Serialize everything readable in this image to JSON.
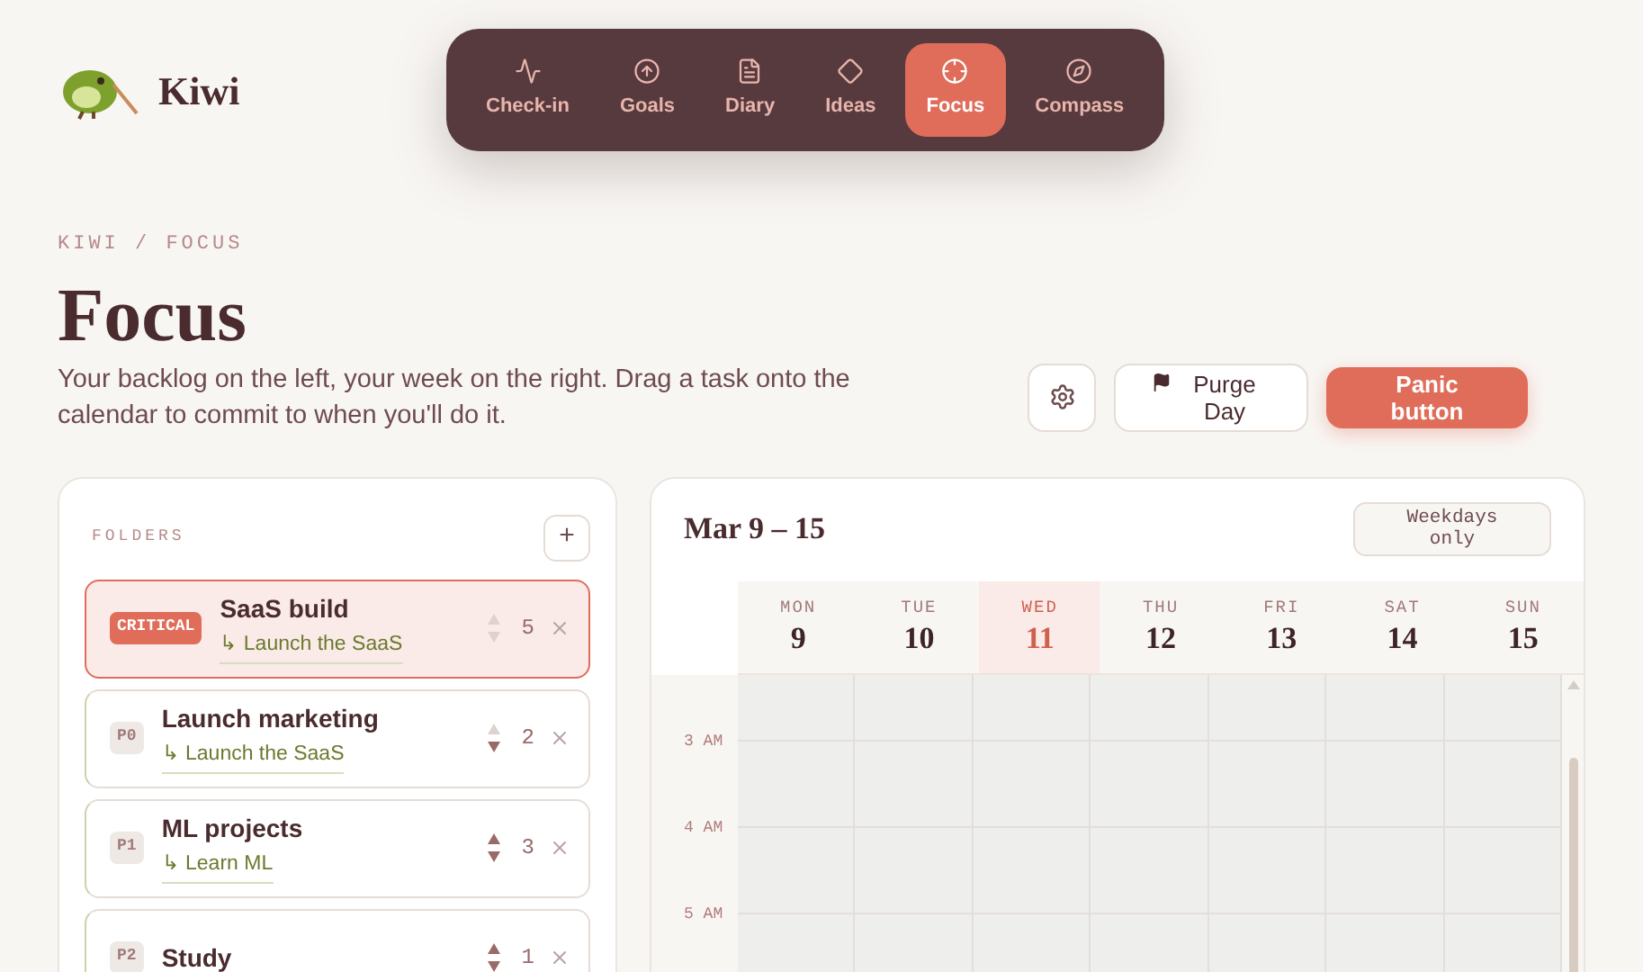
{
  "brand": {
    "name": "Kiwi"
  },
  "nav": [
    {
      "label": "Check-in",
      "selected": false
    },
    {
      "label": "Goals",
      "selected": false
    },
    {
      "label": "Diary",
      "selected": false
    },
    {
      "label": "Ideas",
      "selected": false
    },
    {
      "label": "Focus",
      "selected": true
    },
    {
      "label": "Compass",
      "selected": false
    }
  ],
  "breadcrumb": "KIWI / FOCUS",
  "title": "Focus",
  "subtitle": "Your backlog on the left, your week on the right. Drag a task onto the calendar to commit to when you'll do it.",
  "actions": [
    {
      "kind": "icon"
    },
    {
      "kind": "flag",
      "label": "Purge Day"
    },
    {
      "kind": "primary",
      "label": "Panic button"
    }
  ],
  "folders": {
    "heading": "FOLDERS",
    "add": "+",
    "items": [
      {
        "priority": "CRITICAL",
        "critical": true,
        "name": "SaaS build",
        "goal": "↳ Launch the SaaS",
        "can_move_up": false,
        "can_move_down": false,
        "count": "5"
      },
      {
        "priority": "P0",
        "critical": false,
        "name": "Launch marketing",
        "goal": "↳ Launch the SaaS",
        "can_move_up": false,
        "can_move_down": true,
        "count": "2"
      },
      {
        "priority": "P1",
        "critical": false,
        "name": "ML projects",
        "goal": "↳ Learn ML",
        "can_move_up": true,
        "can_move_down": true,
        "count": "3"
      },
      {
        "priority": "P2",
        "critical": false,
        "name": "Study",
        "can_move_up": true,
        "can_move_down": true,
        "count": "1"
      }
    ]
  },
  "calendar": {
    "range": "Mar 9 – 15",
    "toggle": "Weekdays only",
    "days": [
      {
        "name": "MON",
        "date": "9",
        "selected": false
      },
      {
        "name": "TUE",
        "date": "10",
        "selected": false
      },
      {
        "name": "WED",
        "date": "11",
        "selected": true
      },
      {
        "name": "THU",
        "date": "12",
        "selected": false
      },
      {
        "name": "FRI",
        "date": "13",
        "selected": false
      },
      {
        "name": "SAT",
        "date": "14",
        "selected": false
      },
      {
        "name": "SUN",
        "date": "15",
        "selected": false
      }
    ],
    "hours": [
      "3 AM",
      "4 AM",
      "5 AM"
    ]
  }
}
